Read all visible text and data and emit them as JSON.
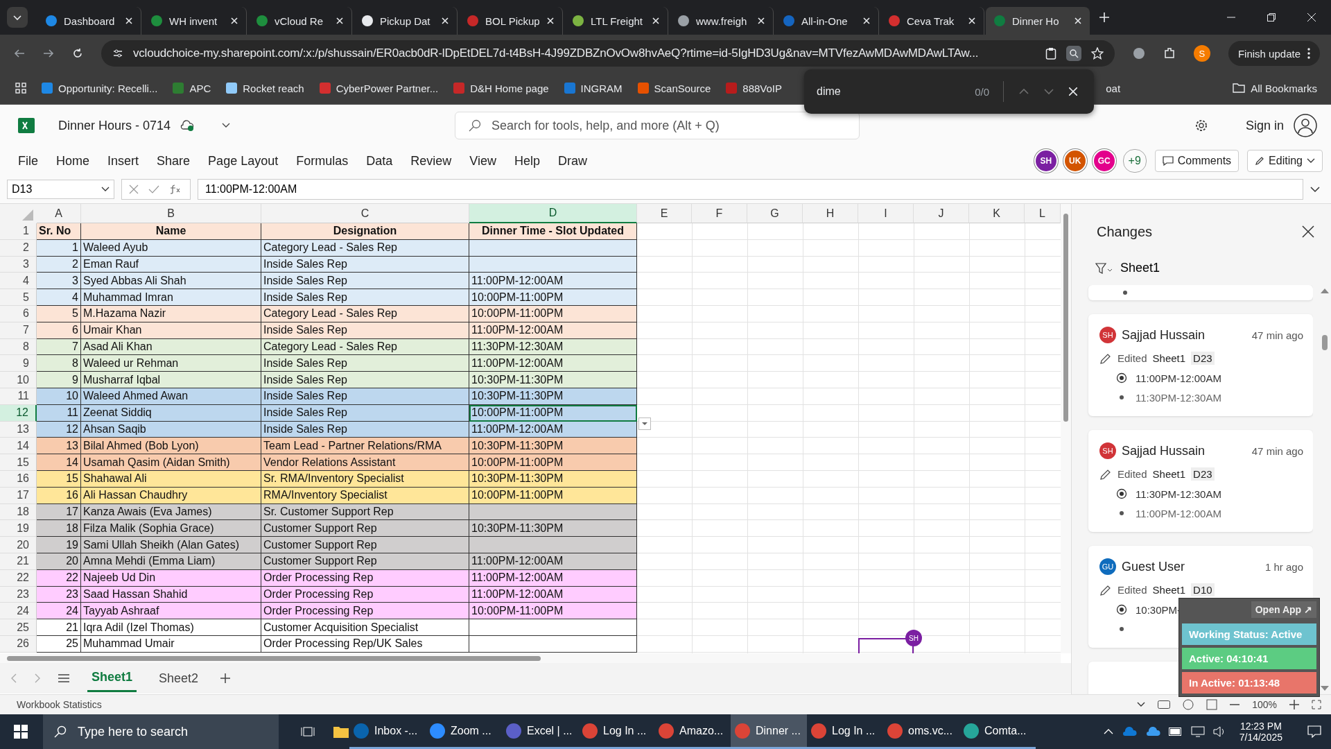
{
  "browser": {
    "tabs": [
      {
        "title": "Dashboard",
        "color": "#1e88e5",
        "selected": false
      },
      {
        "title": "WH invent",
        "color": "#1e8e3e",
        "selected": false
      },
      {
        "title": "vCloud Re",
        "color": "#1e8e3e",
        "selected": false
      },
      {
        "title": "Pickup Dat",
        "color": "#e8eaed",
        "selected": false
      },
      {
        "title": "BOL Pickup",
        "color": "#c62828",
        "selected": false
      },
      {
        "title": "LTL Freight",
        "color": "#7cb342",
        "selected": false
      },
      {
        "title": "www.freigh",
        "color": "#9aa0a6",
        "selected": false
      },
      {
        "title": "All-in-One",
        "color": "#1565c0",
        "selected": false
      },
      {
        "title": "Ceva Trak",
        "color": "#d32f2f",
        "selected": false
      },
      {
        "title": "Dinner Ho",
        "color": "#107c41",
        "selected": true
      }
    ],
    "url": "vcloudchoice-my.sharepoint.com/:x:/p/shussain/ER0acb0dR-lDpEtDEL7d-t4BsH-4J99ZDBZnOvOw8hvAeQ?rtime=id-5IgHD3Ug&nav=MTVfezAwMDAwMDAwLTAw...",
    "profile": "S",
    "update_button": "Finish update",
    "bookmarks": [
      {
        "label": "Opportunity: Recelli...",
        "color": "#1e88e5"
      },
      {
        "label": "APC",
        "color": "#2e7d32"
      },
      {
        "label": "Rocket reach",
        "color": "#90caf9"
      },
      {
        "label": "CyberPower Partner...",
        "color": "#d32f2f"
      },
      {
        "label": "D&H Home page",
        "color": "#c62828"
      },
      {
        "label": "INGRAM",
        "color": "#1976d2"
      },
      {
        "label": "ScanSource",
        "color": "#e65100"
      },
      {
        "label": "888VoIP",
        "color": "#b71c1c"
      }
    ],
    "bookmark_partial": "oat",
    "all_bookmarks": "All Bookmarks",
    "find": {
      "value": "dime",
      "count": "0/0"
    }
  },
  "excel": {
    "title": "Dinner Hours - 0714",
    "search_placeholder": "Search for tools, help, and more (Alt + Q)",
    "sign_in": "Sign in",
    "menu": [
      "File",
      "Home",
      "Insert",
      "Share",
      "Page Layout",
      "Formulas",
      "Data",
      "Review",
      "View",
      "Help",
      "Draw"
    ],
    "collaborators": [
      {
        "initials": "SH",
        "color": "#7b1fa2"
      },
      {
        "initials": "UK",
        "color": "#d35400"
      },
      {
        "initials": "GC",
        "color": "#e3008c"
      }
    ],
    "more_collaborators": "+9",
    "comments": "Comments",
    "editing": "Editing",
    "name_box": "D13",
    "formula": "11:00PM-12:00AM"
  },
  "sheet": {
    "columns": [
      {
        "label": "A",
        "selected": false
      },
      {
        "label": "B",
        "selected": false
      },
      {
        "label": "C",
        "selected": false
      },
      {
        "label": "D",
        "selected": true
      },
      {
        "label": "E",
        "selected": false
      },
      {
        "label": "F",
        "selected": false
      },
      {
        "label": "G",
        "selected": false
      },
      {
        "label": "H",
        "selected": false
      },
      {
        "label": "I",
        "selected": false
      },
      {
        "label": "J",
        "selected": false
      },
      {
        "label": "K",
        "selected": false
      },
      {
        "label": "L",
        "selected": false
      }
    ],
    "header_row": {
      "row_number": "1",
      "sr": "Sr. No",
      "name": "Name",
      "designation": "Designation",
      "time": "Dinner Time - Slot Updated",
      "color": "#fce4d6"
    },
    "rows": [
      {
        "row_number": "2",
        "sr": "1",
        "name": "Waleed Ayub",
        "designation": "Category Lead - Sales Rep",
        "color": "#ddebf7",
        "selected": false
      },
      {
        "row_number": "3",
        "sr": "2",
        "name": "Eman Rauf",
        "designation": "Inside Sales Rep",
        "color": "#ddebf7",
        "selected": false
      },
      {
        "row_number": "4",
        "sr": "3",
        "name": "Syed Abbas Ali Shah",
        "designation": "Inside Sales Rep",
        "time": "11:00PM-12:00AM",
        "color": "#ddebf7",
        "selected": false
      },
      {
        "row_number": "5",
        "sr": "4",
        "name": "Muhammad Imran",
        "designation": "Inside Sales Rep",
        "time": "10:00PM-11:00PM",
        "color": "#ddebf7",
        "selected": false
      },
      {
        "row_number": "6",
        "sr": "5",
        "name": "M.Hazama Nazir",
        "designation": "Category Lead - Sales Rep",
        "time": "10:00PM-11:00PM",
        "color": "#fce4d6",
        "selected": false
      },
      {
        "row_number": "7",
        "sr": "6",
        "name": "Umair Khan",
        "designation": "Inside Sales Rep",
        "time": "11:00PM-12:00AM",
        "color": "#fce4d6",
        "selected": false
      },
      {
        "row_number": "8",
        "sr": "7",
        "name": "Asad Ali Khan",
        "designation": "Category Lead - Sales Rep",
        "time": "11:30PM-12:30AM",
        "color": "#e2efda",
        "selected": false
      },
      {
        "row_number": "9",
        "sr": "8",
        "name": "Waleed ur Rehman",
        "designation": "Inside Sales Rep",
        "time": "11:00PM-12:00AM",
        "color": "#e2efda",
        "selected": false
      },
      {
        "row_number": "10",
        "sr": "9",
        "name": "Musharraf Iqbal",
        "designation": "Inside Sales Rep",
        "time": "10:30PM-11:30PM",
        "color": "#e2efda",
        "selected": false
      },
      {
        "row_number": "11",
        "sr": "10",
        "name": "Waleed Ahmed Awan",
        "designation": "Inside Sales Rep",
        "time": "10:30PM-11:30PM",
        "color": "#bdd7ee",
        "selected": false
      },
      {
        "row_number": "12",
        "sr": "11",
        "name": "Zeenat Siddiq",
        "designation": "Inside Sales Rep",
        "time": "10:00PM-11:00PM",
        "color": "#bdd7ee",
        "selected": true
      },
      {
        "row_number": "13",
        "sr": "12",
        "name": "Ahsan Saqib",
        "designation": "Inside Sales Rep",
        "time": "11:00PM-12:00AM",
        "color": "#bdd7ee",
        "selected": false
      },
      {
        "row_number": "14",
        "sr": "13",
        "name": "Bilal Ahmed (Bob Lyon)",
        "designation": "Team Lead - Partner Relations/RMA",
        "time": "10:30PM-11:30PM",
        "color": "#f8cbad",
        "selected": false
      },
      {
        "row_number": "15",
        "sr": "14",
        "name": "Usamah Qasim (Aidan Smith)",
        "designation": "Vendor Relations Assistant",
        "time": "10:00PM-11:00PM",
        "color": "#f8cbad",
        "selected": false
      },
      {
        "row_number": "16",
        "sr": "15",
        "name": "Shahawal Ali",
        "designation": "Sr. RMA/Inventory Specialist",
        "time": "10:30PM-11:30PM",
        "color": "#ffe699",
        "selected": false
      },
      {
        "row_number": "17",
        "sr": "16",
        "name": "Ali Hassan Chaudhry",
        "designation": "RMA/Inventory Specialist",
        "time": "10:00PM-11:00PM",
        "color": "#ffe699",
        "selected": false
      },
      {
        "row_number": "18",
        "sr": "17",
        "name": "Kanza Awais (Eva James)",
        "designation": "Sr. Customer Support Rep",
        "color": "#d0cece",
        "selected": false
      },
      {
        "row_number": "19",
        "sr": "18",
        "name": "Filza Malik (Sophia Grace)",
        "designation": "Customer Support Rep",
        "time": "10:30PM-11:30PM",
        "color": "#d0cece",
        "selected": false
      },
      {
        "row_number": "20",
        "sr": "19",
        "name": "Sami Ullah Sheikh (Alan Gates)",
        "designation": "Customer Support Rep",
        "color": "#d0cece",
        "selected": false
      },
      {
        "row_number": "21",
        "sr": "20",
        "name": "Amna Mehdi (Emma Liam)",
        "designation": "Customer Support Rep",
        "time": "11:00PM-12:00AM",
        "color": "#d0cece",
        "selected": false
      },
      {
        "row_number": "22",
        "sr": "22",
        "name": "Najeeb Ud Din",
        "designation": "Order Processing Rep",
        "time": "11:00PM-12:00AM",
        "color": "#ffccff",
        "selected": false
      },
      {
        "row_number": "23",
        "sr": "23",
        "name": "Saad Hassan Shahid",
        "designation": "Order Processing Rep",
        "time": "11:00PM-12:00AM",
        "color": "#ffccff",
        "selected": false
      },
      {
        "row_number": "24",
        "sr": "24",
        "name": "Tayyab Ashraaf",
        "designation": "Order Processing Rep",
        "time": "10:00PM-11:00PM",
        "color": "#ffccff",
        "selected": false
      },
      {
        "row_number": "25",
        "sr": "21",
        "name": "Iqra Adil (Izel Thomas)",
        "designation": "Customer Acquisition Specialist",
        "color": "#ffffff",
        "selected": false
      },
      {
        "row_number": "26",
        "sr": "25",
        "name": "Muhammad Umair",
        "designation": "Order Processing Rep/UK Sales",
        "color": "#ffffff",
        "selected": false
      }
    ],
    "presence_marker": "SH",
    "sheet_tabs": [
      {
        "label": "Sheet1",
        "selected": true
      },
      {
        "label": "Sheet2",
        "selected": false
      }
    ]
  },
  "changes_panel": {
    "title": "Changes",
    "filter": "Sheet1",
    "cards": [
      {
        "initials": "SH",
        "color": "#d13438",
        "user": "Sajjad Hussain",
        "time": "47 min ago",
        "action": "Edited",
        "sheet": "Sheet1",
        "cell": "D23",
        "new_value": "11:00PM-12:00AM",
        "old_value": "11:30PM-12:30AM"
      },
      {
        "initials": "SH",
        "color": "#d13438",
        "user": "Sajjad Hussain",
        "time": "47 min ago",
        "action": "Edited",
        "sheet": "Sheet1",
        "cell": "D23",
        "new_value": "11:30PM-12:30AM",
        "old_value": "11:00PM-12:00AM"
      },
      {
        "initials": "GU",
        "color": "#0f6cbd",
        "user": "Guest User",
        "time": "1 hr ago",
        "action": "Edited",
        "sheet": "Sheet1",
        "cell": "D10",
        "new_value": "10:30PM-"
      }
    ]
  },
  "tracker_widget": {
    "open_app": "Open App ↗",
    "status": "Working Status: Active",
    "active": "Active: 04:10:41",
    "inactive": "In Active: 01:13:48"
  },
  "status_bar": {
    "left": "Workbook Statistics",
    "zoom": "100%"
  },
  "taskbar": {
    "search_placeholder": "Type here to search",
    "apps": [
      {
        "label": "Inbox -...",
        "color": "#0a64ad",
        "selected": false
      },
      {
        "label": "Zoom ...",
        "color": "#2d8cff",
        "selected": false
      },
      {
        "label": "Excel | ...",
        "color": "#5b5fc7",
        "selected": false
      },
      {
        "label": "Log In ...",
        "color": "#db4437",
        "selected": false
      },
      {
        "label": "Amazo...",
        "color": "#db4437",
        "selected": false
      },
      {
        "label": "Dinner ...",
        "color": "#db4437",
        "selected": true
      },
      {
        "label": "Log In ...",
        "color": "#db4437",
        "selected": false
      },
      {
        "label": "oms.vc...",
        "color": "#db4437",
        "selected": false
      },
      {
        "label": "Comta...",
        "color": "#26a69a",
        "selected": false
      }
    ],
    "time": "12:23 PM",
    "date": "7/14/2025"
  }
}
